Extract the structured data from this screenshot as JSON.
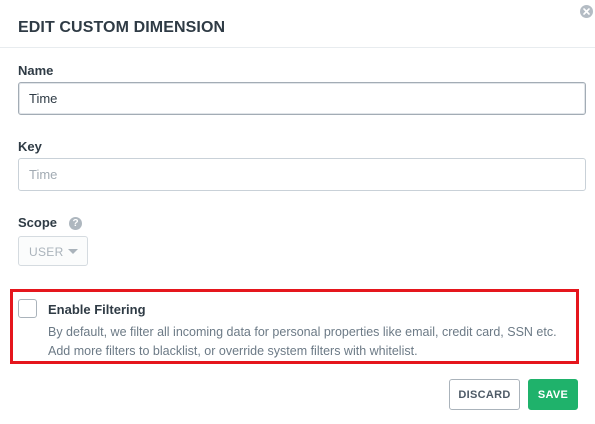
{
  "dialog": {
    "title": "EDIT CUSTOM DIMENSION"
  },
  "fields": {
    "name": {
      "label": "Name",
      "value": "Time"
    },
    "key": {
      "label": "Key",
      "placeholder": "Time"
    },
    "scope": {
      "label": "Scope",
      "help_icon_glyph": "?",
      "selected": "USER"
    }
  },
  "filtering": {
    "label": "Enable Filtering",
    "checked": false,
    "description": "By default, we filter all incoming data for personal properties like email, credit card, SSN etc. Add more filters to blacklist, or override system filters with whitelist."
  },
  "actions": {
    "discard_label": "DISCARD",
    "save_label": "SAVE"
  },
  "colors": {
    "primary_green": "#1fb26b",
    "highlight_red": "#e5161d",
    "text_dark": "#2f3b45",
    "text_muted": "#6c7a86"
  },
  "icons": {
    "close": "close-circle-icon",
    "help": "question-circle-icon",
    "dropdown": "chevron-down-icon"
  }
}
